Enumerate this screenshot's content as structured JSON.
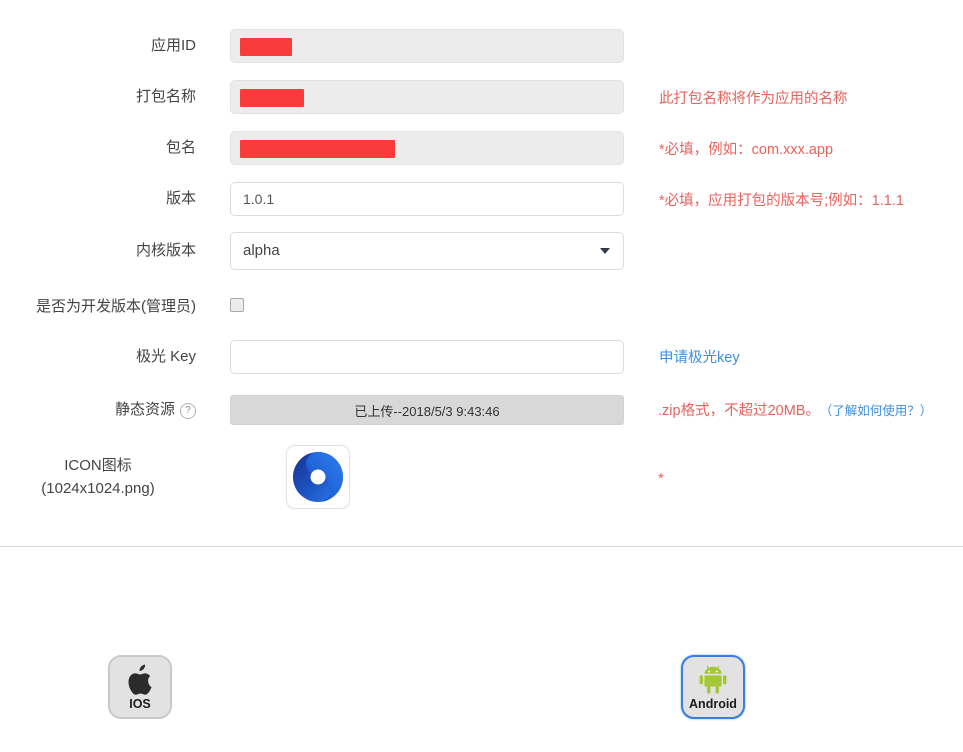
{
  "form": {
    "rows": [
      {
        "key": "app_id",
        "label": "应用ID",
        "type": "readonly-redacted",
        "value": "",
        "placeholder": "",
        "redact_width": 52,
        "hint": "",
        "hint_color": ""
      },
      {
        "key": "package_title",
        "label": "打包名称",
        "type": "readonly-redacted",
        "value": "",
        "placeholder": "",
        "redact_width": 64,
        "hint": "此打包名称将作为应用的名称",
        "hint_color": "#e8625d"
      },
      {
        "key": "package_name",
        "label": "包名",
        "type": "readonly-redacted",
        "value": "",
        "placeholder": "",
        "redact_width": 155,
        "hint": "*必填，例如：com.xxx.app",
        "hint_color": "#e8625d"
      },
      {
        "key": "version",
        "label": "版本",
        "type": "text",
        "value": "1.0.1",
        "placeholder": "",
        "hint": "*必填，应用打包的版本号;例如：1.1.1",
        "hint_color": "#e8625d"
      },
      {
        "key": "kernel_version",
        "label": "内核版本",
        "type": "select",
        "value": "alpha",
        "options": [
          "alpha"
        ],
        "hint": "",
        "hint_color": ""
      },
      {
        "key": "is_dev_build",
        "label": "是否为开发版本(管理员)",
        "type": "checkbox",
        "checked": false,
        "hint": "",
        "hint_color": ""
      },
      {
        "key": "jiguang_key",
        "label": "极光 Key",
        "type": "text",
        "value": "",
        "placeholder": "",
        "hint": "申请极光key",
        "hint_color": "#3c8fe0"
      },
      {
        "key": "static_resource",
        "label": "静态资源",
        "type": "upload",
        "help_icon": "?",
        "value": "已上传--2018/5/3 9:43:46",
        "hint": ".zip格式，不超过20MB。",
        "hint_color": "#e8625d",
        "hint_extra": "（了解如何使用？）"
      },
      {
        "key": "app_icon",
        "label_line1": "ICON图标",
        "label_line2": "(1024x1024.png)",
        "type": "image",
        "icon_name": "blue-swirl-app-icon",
        "hint": "*",
        "hint_color": "#e8625d"
      }
    ]
  },
  "platforms": [
    {
      "key": "ios",
      "label": "IOS",
      "icon_name": "apple-logo-icon",
      "selected": false
    },
    {
      "key": "android",
      "label": "Android",
      "icon_name": "android-robot-icon",
      "selected": true
    }
  ],
  "colors": {
    "redaction": "#f93b3b",
    "hint_red": "#e8625d",
    "hint_blue": "#3c8fe0",
    "android_green": "#a4c639",
    "selected_border": "#3c7ddd"
  }
}
